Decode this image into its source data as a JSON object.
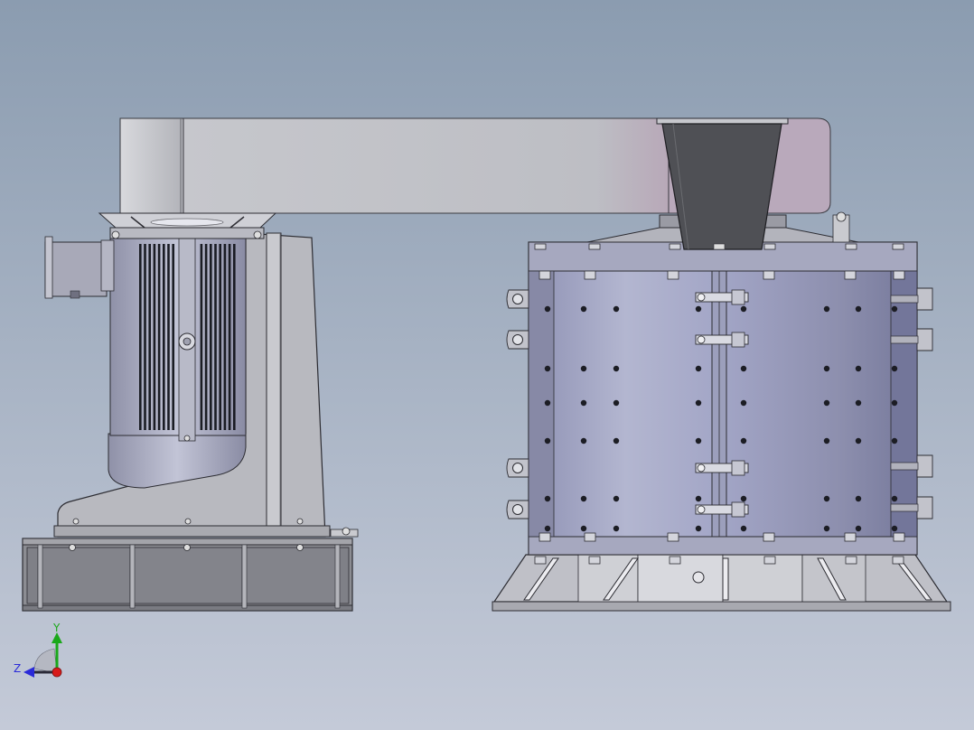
{
  "scene": {
    "background_top": "#8b9cb0",
    "background_bottom": "#c4cad8",
    "steel_light": "#c9cbd2",
    "steel_mid": "#a9abb4",
    "steel_dark": "#6f7280",
    "blue_steel": "#a3a6c4",
    "hopper": "#4f5055",
    "motor_fins": "#1a1c24"
  },
  "triad": {
    "y_label": "Y",
    "z_label": "Z",
    "y_color": "#1aa81a",
    "z_color": "#2a2ad8",
    "origin_color": "#d81a1a"
  }
}
